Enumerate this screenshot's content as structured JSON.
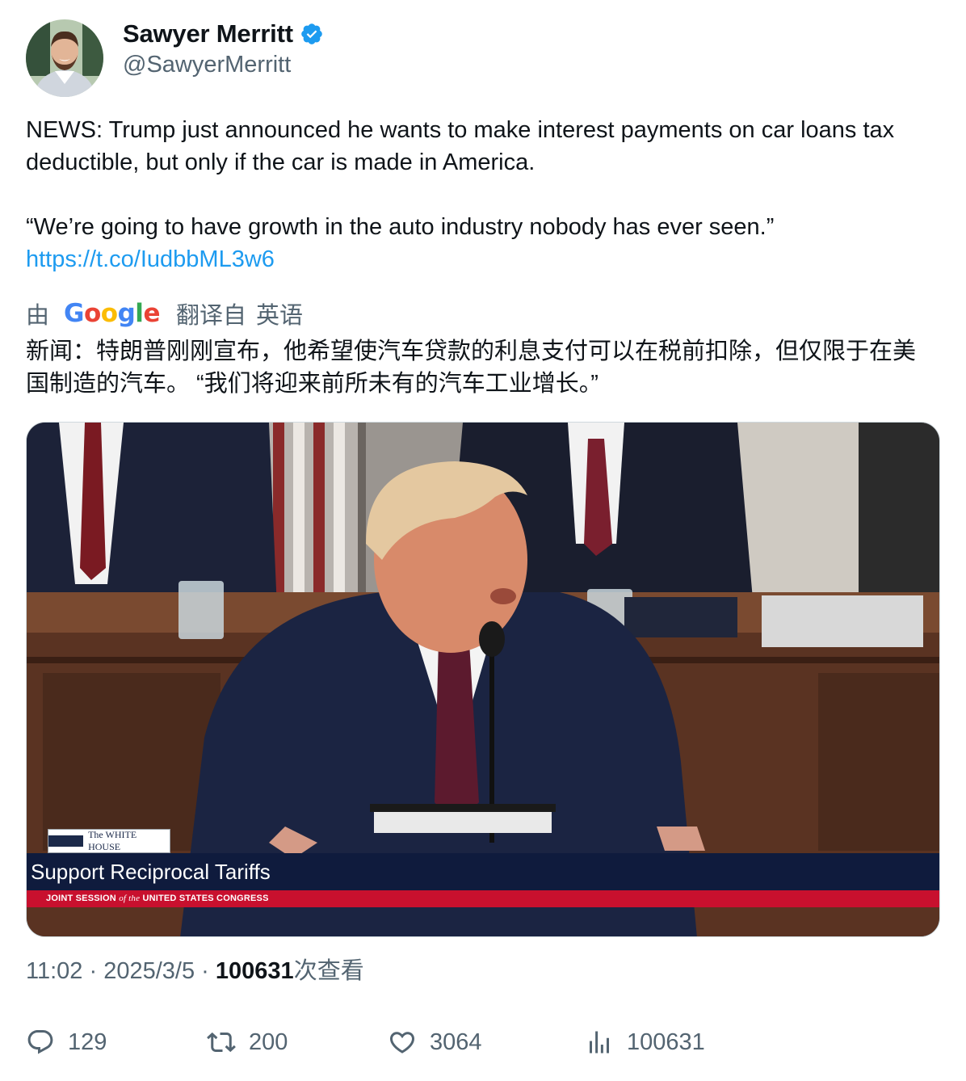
{
  "author": {
    "display_name": "Sawyer Merritt",
    "handle": "@SawyerMerritt",
    "verified": true
  },
  "tweet": {
    "text_line1": "NEWS: Trump just announced he wants to make interest payments on car loans tax deductible, but only if the car is made in America.",
    "text_line2": "“We’re going to have growth in the auto industry nobody has ever seen.”",
    "link": "https://t.co/IudbbML3w6"
  },
  "translation": {
    "by": "由",
    "provider": "Google",
    "from_label": "翻译自",
    "language": "英语",
    "text": "新闻：特朗普刚刚宣布，他希望使汽车贷款的利息支付可以在税前扣除，但仅限于在美国制造的汽车。 “我们将迎来前所未有的汽车工业增长。”"
  },
  "media": {
    "badge_text": "The WHITE HOUSE",
    "lower_third": "Support Reciprocal Tariffs",
    "red_bar_part1": "JOINT SESSION",
    "red_bar_part2": "of the",
    "red_bar_part3": "UNITED STATES CONGRESS"
  },
  "meta": {
    "time": "11:02",
    "sep1": "·",
    "date": "2025/3/5",
    "sep2": "·",
    "views_count": "100631",
    "views_label": "次查看"
  },
  "actions": {
    "replies": "129",
    "retweets": "200",
    "likes": "3064",
    "views": "100631"
  },
  "colors": {
    "accent": "#1d9bf0",
    "muted": "#536471",
    "text": "#0f1419",
    "lower_third_bg": "#0f1b3d",
    "red_bar": "#c8102e"
  },
  "icons": [
    "verified-badge-icon",
    "google-logo",
    "reply-icon",
    "retweet-icon",
    "like-icon",
    "views-icon"
  ]
}
